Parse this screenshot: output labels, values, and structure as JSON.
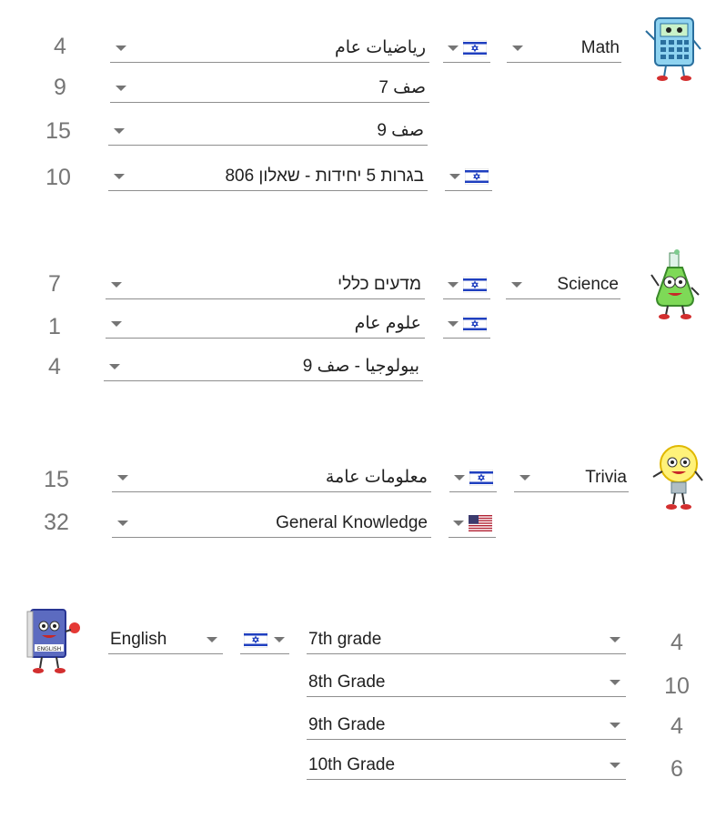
{
  "sections": {
    "math": {
      "subject": "Math",
      "rows": [
        {
          "label": "رياضيات عام",
          "count": "4"
        },
        {
          "label": "صف 7",
          "count": "9"
        },
        {
          "label": "صف 9",
          "count": "15"
        },
        {
          "label": "בגרות 5 יחידות - שאלון 806",
          "count": "10"
        }
      ]
    },
    "science": {
      "subject": "Science",
      "rows": [
        {
          "label": "מדעים כללי",
          "count": "7"
        },
        {
          "label": "علوم عام",
          "count": "1"
        },
        {
          "label": "بيولوجيا - صف 9",
          "count": "4"
        }
      ]
    },
    "trivia": {
      "subject": "Trivia",
      "rows": [
        {
          "label": "معلومات عامة",
          "count": "15"
        },
        {
          "label": "General Knowledge",
          "count": "32"
        }
      ]
    },
    "english": {
      "subject": "English",
      "rows": [
        {
          "label": "7th grade",
          "count": "4"
        },
        {
          "label": "8th Grade",
          "count": "10"
        },
        {
          "label": "9th Grade",
          "count": "4"
        },
        {
          "label": "10th Grade",
          "count": "6"
        }
      ]
    }
  },
  "icons": {
    "israel_flag": "israel-flag-icon",
    "us_flag": "us-flag-icon",
    "dropdown": "chevron-down-icon"
  },
  "colors": {
    "flag_blue": "#1f3fbf",
    "underline": "#8e8e8e",
    "caret": "#757575",
    "count_text": "#757575"
  }
}
